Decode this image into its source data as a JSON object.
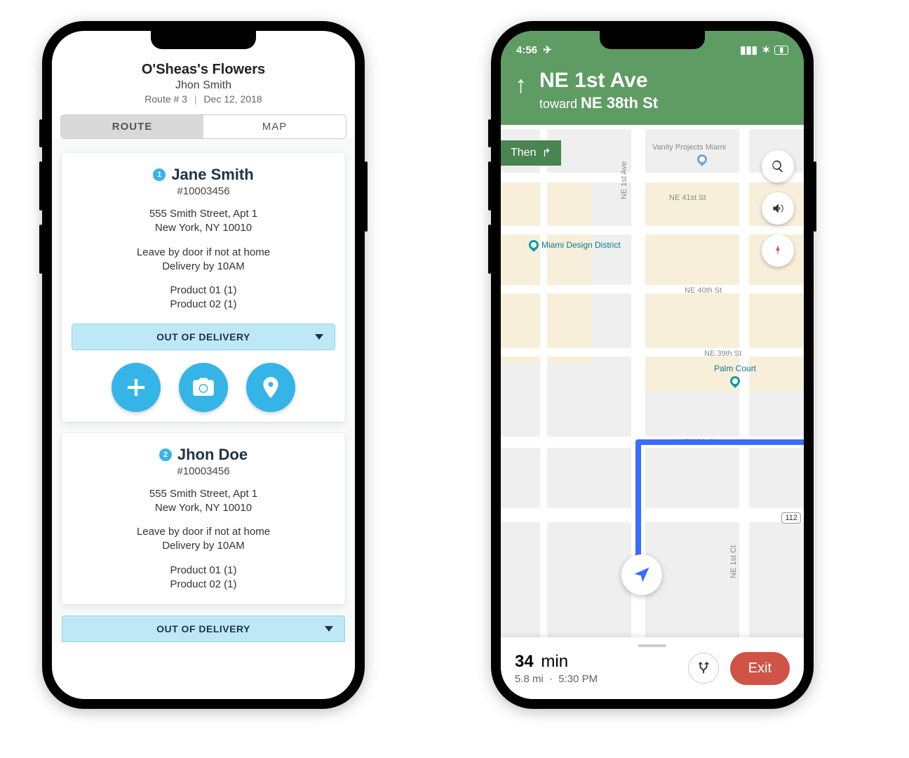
{
  "phone1": {
    "header": {
      "company": "O'Sheas's Flowers",
      "driver": "Jhon Smith",
      "route_label": "Route # 3",
      "sep": "|",
      "date": "Dec 12, 2018"
    },
    "tabs": {
      "route": "ROUTE",
      "map": "MAP",
      "active": "route"
    },
    "stops": [
      {
        "index": "1",
        "name": "Jane Smith",
        "order_no": "#10003456",
        "addr1": "555 Smith Street, Apt 1",
        "addr2": "New York, NY 10010",
        "note1": "Leave by door if not at home",
        "note2": "Delivery by 10AM",
        "prod1": "Product 01 (1)",
        "prod2": "Product 02 (1)",
        "status": "OUT OF DELIVERY"
      },
      {
        "index": "2",
        "name": "Jhon Doe",
        "order_no": "#10003456",
        "addr1": "555 Smith Street, Apt 1",
        "addr2": "New York, NY 10010",
        "note1": "Leave by door if not at home",
        "note2": "Delivery by 10AM",
        "prod1": "Product 01 (1)",
        "prod2": "Product 02 (1)",
        "status": "OUT OF DELIVERY"
      }
    ],
    "action_icons": {
      "add": "plus-icon",
      "camera": "camera-icon",
      "location": "location-pin-icon"
    }
  },
  "phone2": {
    "statusbar": {
      "time": "4:56",
      "nav_glyph": "➤"
    },
    "direction": {
      "street": "NE 1st Ave",
      "toward_label": "toward",
      "toward_street": "NE 38th St",
      "then_label": "Then"
    },
    "map_labels": {
      "vanity": "Vanity Projects Miami",
      "ne41": "NE 41st St",
      "mdd": "Miami Design District",
      "ne40": "NE 40th St",
      "ne39": "NE 39th St",
      "palm": "Palm Court",
      "ne38": "NE 38th St",
      "ne1ave": "NE 1st Ave",
      "ne1ct": "NE 1st Ct",
      "hwy": "112"
    },
    "bottom": {
      "eta_min_value": "34",
      "eta_min_unit": "min",
      "distance": "5.8 mi",
      "dot": "·",
      "arrive": "5:30 PM",
      "exit": "Exit"
    }
  }
}
